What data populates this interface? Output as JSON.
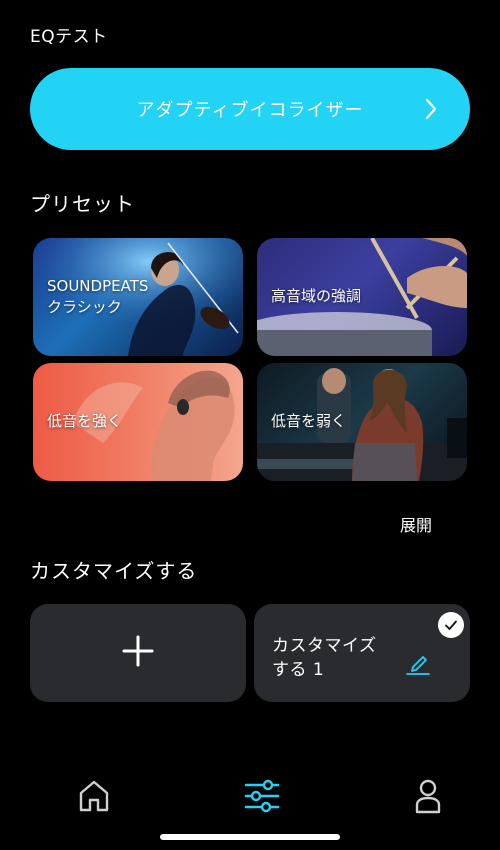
{
  "header": {
    "title": "EQテスト"
  },
  "adaptive_eq": {
    "label": "アダプティブイコライザー",
    "icon": "chevron-right-icon"
  },
  "presets": {
    "title": "プリセット",
    "items": [
      {
        "line1": "SOUNDPEATS",
        "line2": "クラシック"
      },
      {
        "line1": "高音域の強調",
        "line2": ""
      },
      {
        "line1": "低音を強く",
        "line2": ""
      },
      {
        "line1": "低音を弱く",
        "line2": ""
      }
    ],
    "expand_label": "展開"
  },
  "custom": {
    "title": "カスタマイズする",
    "add_icon": "plus-icon",
    "items": [
      {
        "line1": "カスタマイズ",
        "line2": "する 1",
        "selected": true
      }
    ]
  },
  "tabbar": {
    "items": [
      {
        "icon": "home-icon",
        "active": false
      },
      {
        "icon": "equalizer-icon",
        "active": true
      },
      {
        "icon": "profile-icon",
        "active": false
      }
    ]
  },
  "colors": {
    "accent": "#22d3f6",
    "background": "#000000",
    "tile": "#2a2b2e",
    "inactive_icon": "#d0d0d0"
  }
}
